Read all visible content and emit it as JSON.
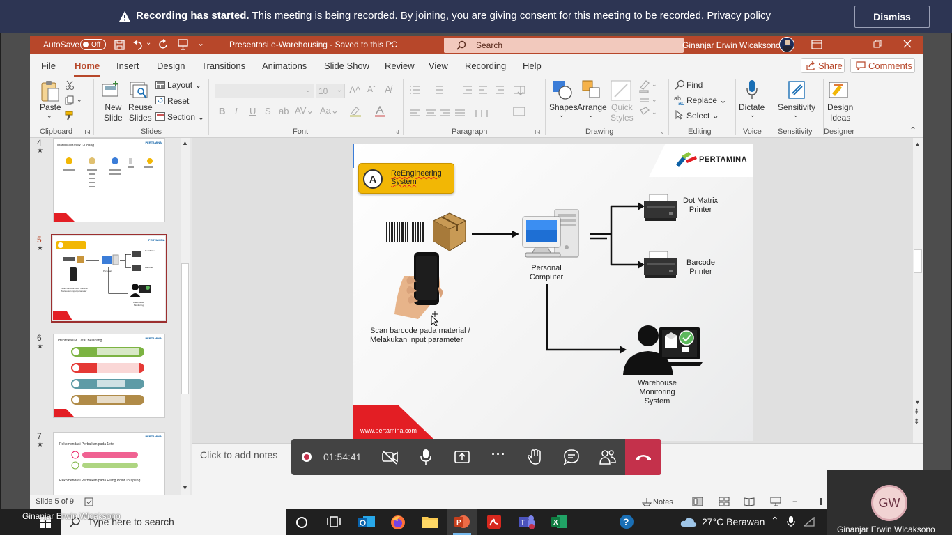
{
  "banner": {
    "bold": "Recording has started.",
    "text": " This meeting is being recorded. By joining, you are giving consent for this meeting to be recorded. ",
    "link": "Privacy policy",
    "dismiss": "Dismiss"
  },
  "titlebar": {
    "autosave": "AutoSave",
    "autosave_state": "Off",
    "doc_title": "Presentasi e-Warehousing  -  Saved to this PC",
    "search": "Search",
    "user": "Ginanjar Erwin Wicaksono"
  },
  "ribbon": {
    "tabs": [
      "File",
      "Home",
      "Insert",
      "Design",
      "Transitions",
      "Animations",
      "Slide Show",
      "Review",
      "View",
      "Recording",
      "Help"
    ],
    "active_tab": "Home",
    "share": "Share",
    "comments": "Comments",
    "clipboard": {
      "paste": "Paste",
      "group": "Clipboard"
    },
    "slides": {
      "new_slide": "New\nSlide",
      "reuse": "Reuse\nSlides",
      "layout": "Layout",
      "reset": "Reset",
      "section": "Section",
      "group": "Slides"
    },
    "font": {
      "size": "10",
      "group": "Font",
      "bold": "B",
      "italic": "I",
      "underline": "U",
      "strike": "S",
      "shadow": "ab"
    },
    "paragraph": {
      "group": "Paragraph"
    },
    "drawing": {
      "shapes": "Shapes",
      "arrange": "Arrange",
      "quick_styles": "Quick\nStyles",
      "group": "Drawing"
    },
    "editing": {
      "find": "Find",
      "replace": "Replace",
      "select": "Select",
      "group": "Editing"
    },
    "voice": {
      "dictate": "Dictate",
      "group": "Voice"
    },
    "sensitivity": {
      "label": "Sensitivity",
      "group": "Sensitivity"
    },
    "designer": {
      "ideas": "Design\nIdeas",
      "group": "Designer"
    }
  },
  "panel": {
    "slides": [
      {
        "num": "4",
        "title": "Material Masuk Gudang"
      },
      {
        "num": "5",
        "title": "ReEngineering System"
      },
      {
        "num": "6",
        "title": "Identifikasi & Latar Belakang"
      },
      {
        "num": "7",
        "title": "Rekomendasi Perbaikan pada 1ete",
        "sub": "Rekomendasi Perbaikan pada Filling Point Torapeng"
      }
    ]
  },
  "slide": {
    "badge_letter": "A",
    "badge_text": "ReEngineering\nSystem",
    "brand": "PERTAMINA",
    "dot_matrix": "Dot Matrix\nPrinter",
    "barcode_printer": "Barcode\nPrinter",
    "pc": "Personal\nComputer",
    "scan": "Scan barcode pada material /\nMelakukan input parameter",
    "wms": "Warehouse\nMonitoring\nSystem",
    "footer_url": "www.pertamina.com"
  },
  "notes": {
    "placeholder": "Click to add notes"
  },
  "status": {
    "slide": "Slide 5 of 9",
    "notes_btn": "Notes"
  },
  "call": {
    "timer": "01:54:41"
  },
  "taskbar": {
    "search_placeholder": "Type here to search",
    "weather": "27°C  Berawan",
    "presenter_overlay": "Ginanjar Erwin Wicaksono"
  },
  "self_video": {
    "initials": "GW",
    "name": "Ginanjar Erwin Wicaksono"
  },
  "colors": {
    "ppt_red": "#b7472a",
    "banner": "#2d3553",
    "badge_yellow": "#f2b705",
    "end_call": "#c4314b",
    "pertamina_red": "#e31e24",
    "pertamina_blue": "#0b5fa5",
    "pertamina_green": "#8cc63f"
  }
}
